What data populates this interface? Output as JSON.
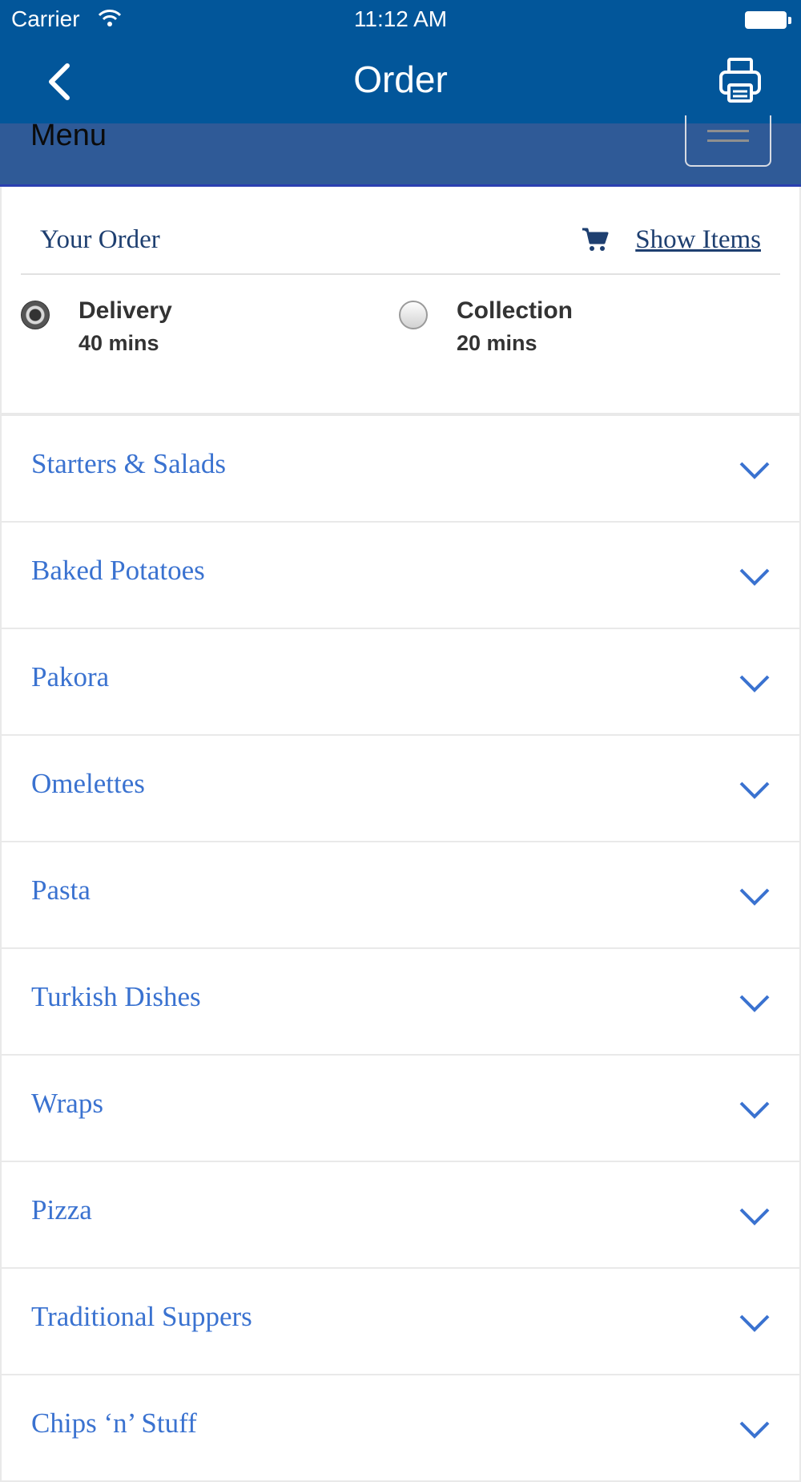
{
  "status_bar": {
    "carrier": "Carrier",
    "time": "11:12 AM"
  },
  "nav": {
    "title": "Order",
    "back_icon": "chevron-left-icon",
    "print_icon": "printer-icon"
  },
  "menu_strip": {
    "label": "Menu"
  },
  "order": {
    "heading": "Your Order",
    "show_items": "Show Items",
    "options": [
      {
        "label": "Delivery",
        "time": "40 mins",
        "selected": true
      },
      {
        "label": "Collection",
        "time": "20 mins",
        "selected": false
      }
    ]
  },
  "categories": [
    "Starters & Salads",
    "Baked Potatoes",
    "Pakora",
    "Omelettes",
    "Pasta",
    "Turkish Dishes",
    "Wraps",
    "Pizza",
    "Traditional Suppers",
    "Chips ‘n’ Stuff"
  ],
  "colors": {
    "bar_blue": "#02569a",
    "link_blue": "#3a72d0",
    "heading_navy": "#1e3f70"
  }
}
